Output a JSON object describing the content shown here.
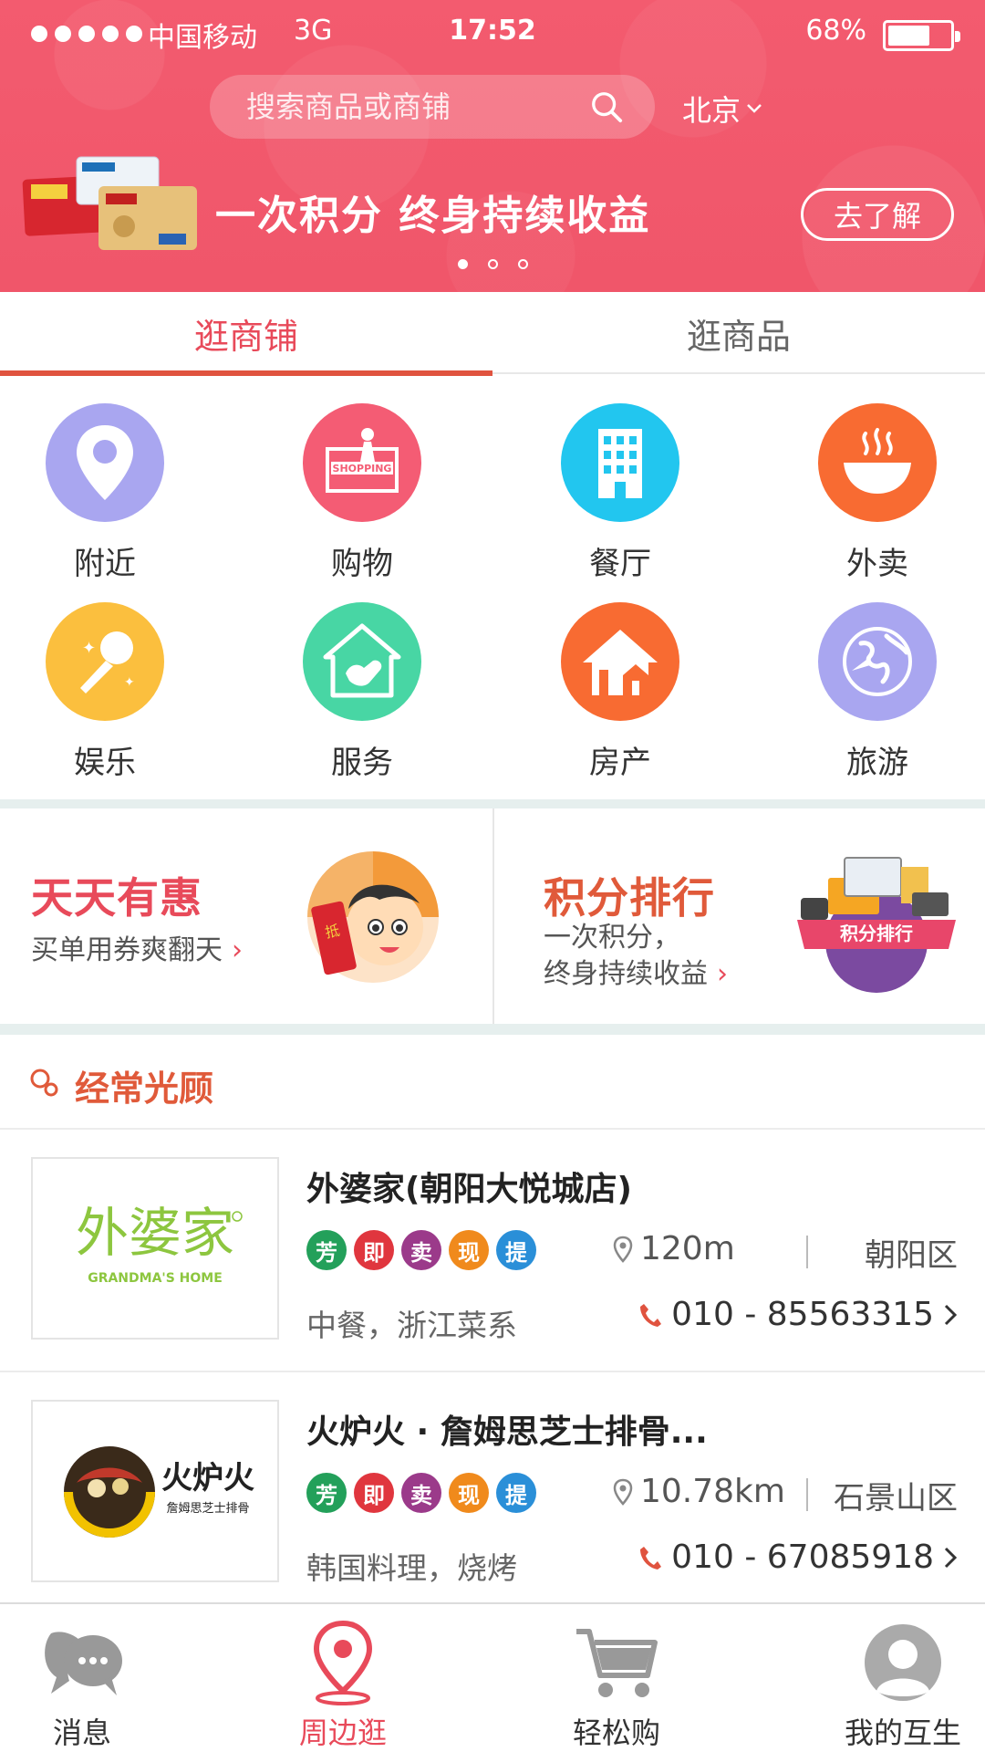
{
  "status_bar": {
    "carrier": "中国移动",
    "network": "3G",
    "time": "17:52",
    "battery": "68%",
    "battery_level": 0.68
  },
  "header": {
    "search_placeholder": "搜索商品或商铺",
    "city": "北京",
    "banner": {
      "text": "一次积分  终身持续收益",
      "button": "去了解",
      "dots_count": 3,
      "active_dot": 0
    }
  },
  "tabs": [
    {
      "label": "逛商铺",
      "active": true
    },
    {
      "label": "逛商品",
      "active": false
    }
  ],
  "categories": [
    {
      "label": "附近",
      "icon": "location-pin-icon",
      "color": "#a9a6f0"
    },
    {
      "label": "购物",
      "icon": "shopping-icon",
      "color": "#f45c74"
    },
    {
      "label": "餐厅",
      "icon": "building-icon",
      "color": "#22c6ef"
    },
    {
      "label": "外卖",
      "icon": "bowl-icon",
      "color": "#f86b32"
    },
    {
      "label": "娱乐",
      "icon": "microphone-icon",
      "color": "#fbbf3e"
    },
    {
      "label": "服务",
      "icon": "handshake-home-icon",
      "color": "#48d6a4"
    },
    {
      "label": "房产",
      "icon": "house-icon",
      "color": "#f86b32"
    },
    {
      "label": "旅游",
      "icon": "globe-plane-icon",
      "color": "#a9a6f0"
    }
  ],
  "promos": [
    {
      "title": "天天有惠",
      "title_color": "#e84a5a",
      "subtitle_lines": [
        "买单用券爽翻天"
      ]
    },
    {
      "title": "积分排行",
      "title_color": "#e05a3a",
      "subtitle_lines": [
        "一次积分，",
        "终身持续收益"
      ]
    }
  ],
  "frequent": {
    "title": "经常光顾"
  },
  "shops": [
    {
      "name": "外婆家(朝阳大悦城店)",
      "logo_text": "外婆家",
      "logo_sub": "GRANDMA'S HOME",
      "badges": [
        "芳",
        "即",
        "卖",
        "现",
        "提"
      ],
      "distance": "120m",
      "district": "朝阳区",
      "cuisine": "中餐，浙江菜系",
      "phone": "010 - 85563315"
    },
    {
      "name": "火炉火 · 詹姆思芝士排骨...",
      "logo_text": "火炉火",
      "logo_sub": "詹姆思芝士排骨",
      "badges": [
        "芳",
        "即",
        "卖",
        "现",
        "提"
      ],
      "distance": "10.78km",
      "district": "石景山区",
      "cuisine": "韩国料理，烧烤",
      "phone": "010 - 67085918"
    }
  ],
  "badge_colors": [
    "#23a05a",
    "#e0363e",
    "#9b3a8a",
    "#f08a1c",
    "#2a8fd8"
  ],
  "bottom_nav": [
    {
      "label": "消息",
      "icon": "chat-bubbles-icon",
      "active": false
    },
    {
      "label": "周边逛",
      "icon": "location-pin-icon",
      "active": true
    },
    {
      "label": "轻松购",
      "icon": "cart-icon",
      "active": false
    },
    {
      "label": "我的互生",
      "icon": "avatar-icon",
      "active": false
    }
  ],
  "colors": {
    "brand": "#f0566a",
    "accent": "#e84a5a"
  }
}
